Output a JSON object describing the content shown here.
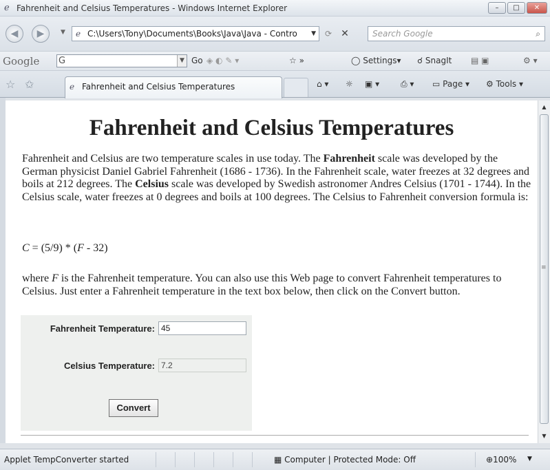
{
  "window": {
    "title": "Fahrenheit and Celsius Temperatures - Windows Internet Explorer",
    "minimize": "–",
    "maximize": "□",
    "close": "✕"
  },
  "addressbar": {
    "url": "C:\\Users\\Tony\\Documents\\Books\\Java\\Java - Contro",
    "search_placeholder": "Search Google"
  },
  "google_toolbar": {
    "logo": "Google",
    "search_value": "G",
    "go": "Go",
    "settings": "Settings",
    "snagit": "SnagIt"
  },
  "tabs": [
    {
      "label": "Fahrenheit and Celsius Temperatures"
    }
  ],
  "commands": {
    "page": "Page",
    "tools": "Tools"
  },
  "page": {
    "heading": "Fahrenheit and Celsius Temperatures",
    "intro": {
      "t1": "Fahrenheit and Celsius are two temperature scales in use today. The ",
      "b1": "Fahrenheit",
      "t2": " scale was developed by the German physicist Daniel Gabriel Fahrenheit (1686 - 1736). In the Fahrenheit scale, water freezes at 32 degrees and boils at 212 degrees. The ",
      "b2": "Celsius",
      "t3": " scale was developed by Swedish astronomer Andres Celsius (1701 - 1744). In the Celsius scale, water freezes at 0 degrees and boils at 100 degrees. The Celsius to Fahrenheit conversion formula is:"
    },
    "formula": {
      "c": "C",
      "mid": " = (5/9) * (",
      "f": "F",
      "end": " - 32)"
    },
    "where": {
      "t1": "where ",
      "f": "F",
      "t2": " is the Fahrenheit temperature. You can also use this Web page to convert Fahrenheit temperatures to Celsius. Just enter a Fahrenheit temperature in the text box below, then click on the Convert button."
    }
  },
  "applet": {
    "fahrenheit_label": "Fahrenheit Temperature:",
    "fahrenheit_value": "45",
    "celsius_label": "Celsius Temperature:",
    "celsius_value": "7.2",
    "convert_label": "Convert"
  },
  "statusbar": {
    "text": "Applet TempConverter started",
    "zone": "Computer | Protected Mode: Off",
    "zoom": "100%"
  },
  "icons": [
    "ie-logo-icon",
    "back-icon",
    "forward-icon",
    "page-icon",
    "refresh-icon",
    "stop-icon",
    "search-icon",
    "favorites-star-icon",
    "add-favorites-icon",
    "home-icon",
    "feeds-icon",
    "print-icon",
    "page-menu-icon",
    "tools-gear-icon",
    "computer-icon",
    "zoom-icon"
  ]
}
